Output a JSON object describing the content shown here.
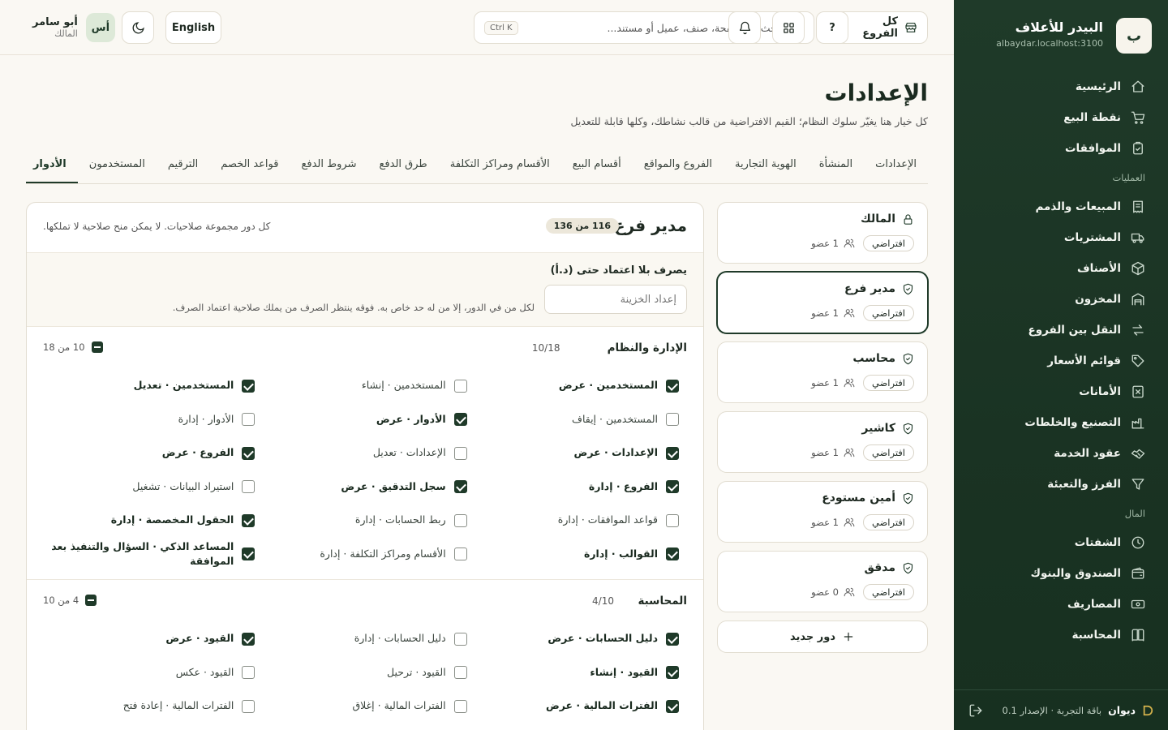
{
  "sidebar": {
    "logo_letter": "ب",
    "brand_name": "البيدر للأعلاف",
    "domain": "albaydar.localhost:3100",
    "items_main": [
      {
        "label": "الرئيسية",
        "icon": "home-icon"
      },
      {
        "label": "نقطة البيع",
        "icon": "cart-icon"
      },
      {
        "label": "الموافقات",
        "icon": "clipboard-check-icon"
      }
    ],
    "section_ops": "العمليات",
    "items_ops": [
      {
        "label": "المبيعات والذمم",
        "icon": "receipt-icon"
      },
      {
        "label": "المشتريات",
        "icon": "truck-icon"
      },
      {
        "label": "الأصناف",
        "icon": "box-icon"
      },
      {
        "label": "المخزون",
        "icon": "warehouse-icon"
      },
      {
        "label": "النقل بين الفروع",
        "icon": "transfer-icon"
      },
      {
        "label": "قوائم الأسعار",
        "icon": "tag-icon"
      },
      {
        "label": "الأمانات",
        "icon": "x-box-icon"
      },
      {
        "label": "التصنيع والخلطات",
        "icon": "factory-icon"
      },
      {
        "label": "عقود الخدمة",
        "icon": "handshake-icon"
      },
      {
        "label": "الفرز والتعبئة",
        "icon": "filter-icon"
      }
    ],
    "section_finance": "المال",
    "items_finance": [
      {
        "label": "الشفتات",
        "icon": "clock-icon"
      },
      {
        "label": "الصندوق والبنوك",
        "icon": "wallet-icon"
      },
      {
        "label": "المصاريف",
        "icon": "banknote-icon"
      },
      {
        "label": "المحاسبة",
        "icon": "book-icon"
      }
    ],
    "footer": {
      "app_name": "ديوان",
      "version": "باقة التجربة · الإصدار 0.1"
    }
  },
  "topbar": {
    "branch": "كل الفروع",
    "search_placeholder": "ابحث عن صفحة، صنف، عميل أو مستند...",
    "search_shortcut": "Ctrl K",
    "help_label": "?",
    "language": "English",
    "user_name": "أبو سامر",
    "user_role": "المالك",
    "user_initials": "أس"
  },
  "page": {
    "title": "الإعدادات",
    "subtitle": "كل خيار هنا يغيّر سلوك النظام؛ القيم الافتراضية من قالب نشاطك، وكلها قابلة للتعديل"
  },
  "tabs": [
    "الإعدادات",
    "المنشأة",
    "الهوية التجارية",
    "الفروع والمواقع",
    "أقسام البيع",
    "الأقسام ومراكز التكلفة",
    "طرق الدفع",
    "شروط الدفع",
    "قواعد الخصم",
    "الترقيم",
    "المستخدمون",
    "الأدوار"
  ],
  "active_tab_index": 11,
  "roles": [
    {
      "name": "المالك",
      "icon": "lock-icon",
      "badge": "افتراضي",
      "members": "1 عضو",
      "selected": false
    },
    {
      "name": "مدير فرع",
      "icon": "shield-check-icon",
      "badge": "افتراضي",
      "members": "1 عضو",
      "selected": true
    },
    {
      "name": "محاسب",
      "icon": "shield-check-icon",
      "badge": "افتراضي",
      "members": "1 عضو",
      "selected": false
    },
    {
      "name": "كاشير",
      "icon": "shield-check-icon",
      "badge": "افتراضي",
      "members": "1 عضو",
      "selected": false
    },
    {
      "name": "أمين مستودع",
      "icon": "shield-check-icon",
      "badge": "افتراضي",
      "members": "1 عضو",
      "selected": false
    },
    {
      "name": "مدقق",
      "icon": "shield-check-icon",
      "badge": "افتراضي",
      "members": "0 عضو",
      "selected": false
    }
  ],
  "new_role_label": "دور جديد",
  "detail": {
    "title": "مدير فرع",
    "count": "116 من 136",
    "note": "كل دور مجموعة صلاحيات. لا يمكن منح صلاحية لا تملكها.",
    "approval_label": "يصرف بلا اعتماد حتى (د.أ)",
    "approval_placeholder": "إعداد الخزينة",
    "approval_help": "لكل من في الدور، إلا من له حد خاص به. فوقه ينتظر الصرف من يملك صلاحية اعتماد الصرف.",
    "groups": [
      {
        "title": "الإدارة والنظام",
        "fraction": "10/18",
        "summary": "10 من 18",
        "perms": [
          {
            "label": "المستخدمين · عرض",
            "checked": true
          },
          {
            "label": "المستخدمين · إنشاء",
            "checked": false
          },
          {
            "label": "المستخدمين · تعديل",
            "checked": true
          },
          {
            "label": "المستخدمين · إيقاف",
            "checked": false
          },
          {
            "label": "الأدوار · عرض",
            "checked": true
          },
          {
            "label": "الأدوار · إدارة",
            "checked": false
          },
          {
            "label": "الإعدادات · عرض",
            "checked": true
          },
          {
            "label": "الإعدادات · تعديل",
            "checked": false
          },
          {
            "label": "الفروع · عرض",
            "checked": true
          },
          {
            "label": "الفروع · إدارة",
            "checked": true
          },
          {
            "label": "سجل التدقيق · عرض",
            "checked": true
          },
          {
            "label": "استيراد البيانات · تشغيل",
            "checked": false
          },
          {
            "label": "قواعد الموافقات · إدارة",
            "checked": false
          },
          {
            "label": "ربط الحسابات · إدارة",
            "checked": false
          },
          {
            "label": "الحقول المخصصة · إدارة",
            "checked": true
          },
          {
            "label": "القوالب · إدارة",
            "checked": true
          },
          {
            "label": "الأقسام ومراكز التكلفة · إدارة",
            "checked": false
          },
          {
            "label": "المساعد الذكي · السؤال والتنفيذ بعد الموافقة",
            "checked": true
          }
        ]
      },
      {
        "title": "المحاسبة",
        "fraction": "4/10",
        "summary": "4 من 10",
        "perms": [
          {
            "label": "دليل الحسابات · عرض",
            "checked": true
          },
          {
            "label": "دليل الحسابات · إدارة",
            "checked": false
          },
          {
            "label": "القيود · عرض",
            "checked": true
          },
          {
            "label": "القيود · إنشاء",
            "checked": true
          },
          {
            "label": "القيود · ترحيل",
            "checked": false
          },
          {
            "label": "القيود · عكس",
            "checked": false
          },
          {
            "label": "الفترات المالية · عرض",
            "checked": true
          },
          {
            "label": "الفترات المالية · إغلاق",
            "checked": false
          },
          {
            "label": "الفترات المالية · إعادة فتح",
            "checked": false
          }
        ]
      }
    ]
  },
  "colors": {
    "sidebar_bg": "#1f3a29",
    "accent": "#1f3a29",
    "page_bg": "#faf8f3",
    "footer_icon": "#d4b24c"
  }
}
